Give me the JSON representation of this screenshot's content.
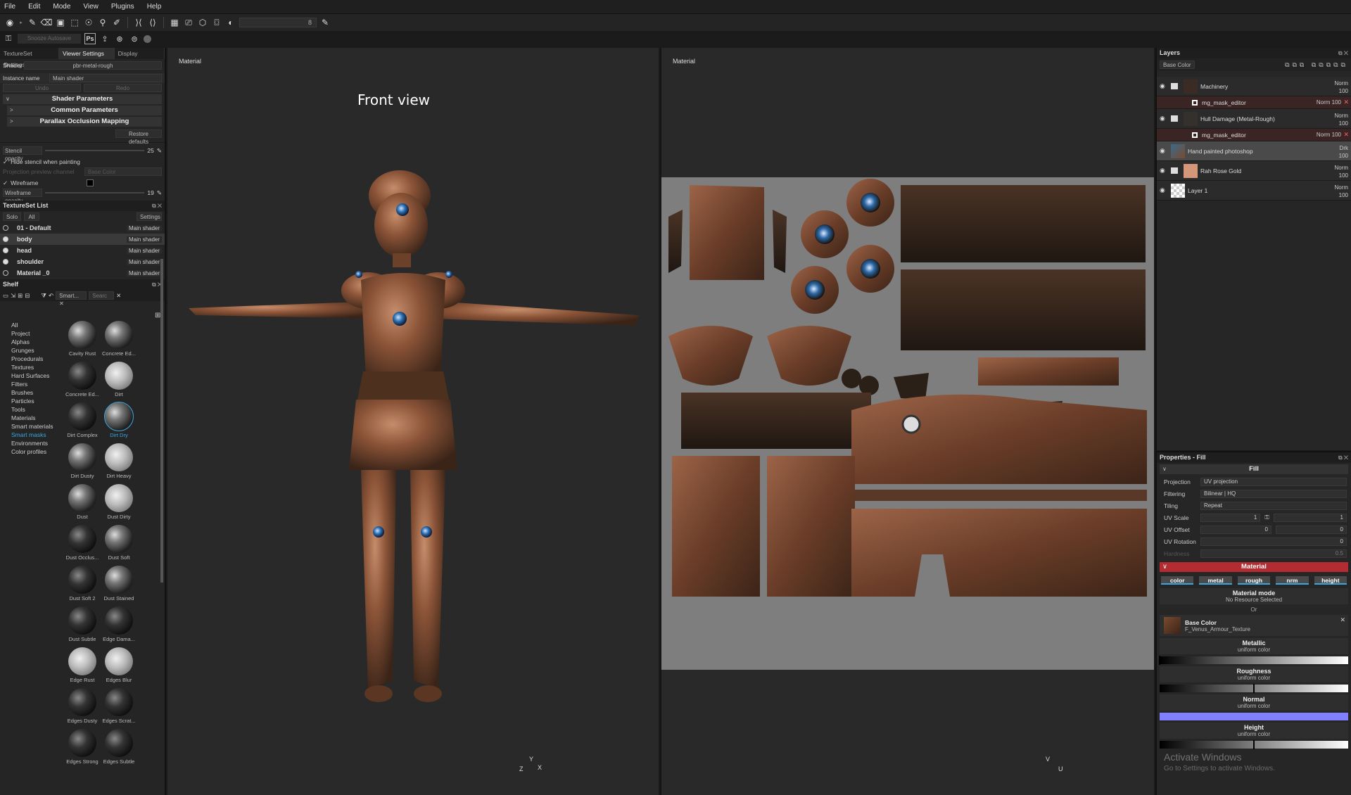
{
  "menubar": [
    "File",
    "Edit",
    "Mode",
    "View",
    "Plugins",
    "Help"
  ],
  "toolbar": {
    "value_field": "8"
  },
  "toolbar2": {
    "autosave_label": "Snooze Autosave",
    "ps_label": "Ps"
  },
  "left": {
    "tabs": [
      "TextureSet Settings",
      "Viewer Settings",
      "Display Settings"
    ],
    "shader_label": "Shader",
    "shader_value": "pbr-metal-rough",
    "instance_label": "Instance name",
    "instance_value": "Main shader",
    "undo": "Undo",
    "redo": "Redo",
    "sections": [
      "Shader Parameters",
      "Common Parameters",
      "Parallax Occlusion Mapping"
    ],
    "restore": "Restore defaults",
    "stencil_opacity_label": "Stencil opacity",
    "stencil_opacity_value": "25",
    "hide_stencil": "Hide stencil when painting",
    "projection_channel_label": "Projection preview channel",
    "projection_channel_value": "Base Color",
    "wireframe": "Wireframe",
    "wireframe_opacity_label": "Wireframe opacity",
    "wireframe_opacity_value": "19",
    "textureset_title": "TextureSet List",
    "solo": "Solo",
    "all": "All",
    "settings": "Settings",
    "texturesets": [
      {
        "name": "01 - Default",
        "shader": "Main shader"
      },
      {
        "name": "body",
        "shader": "Main shader"
      },
      {
        "name": "head",
        "shader": "Main shader"
      },
      {
        "name": "shoulder",
        "shader": "Main shader"
      },
      {
        "name": "Material _0",
        "shader": "Main shader"
      }
    ],
    "shelf_title": "Shelf",
    "shelf_tab": "Smart...",
    "shelf_search": "Searc",
    "categories": [
      "All",
      "Project",
      "Alphas",
      "Grunges",
      "Procedurals",
      "Textures",
      "Hard Surfaces",
      "Filters",
      "Brushes",
      "Particles",
      "Tools",
      "Materials",
      "Smart materials",
      "Smart masks",
      "Environments",
      "Color profiles"
    ],
    "shelf_items": [
      "Cavity Rust",
      "Concrete Ed...",
      "Concrete Ed...",
      "Dirt",
      "Dirt Complex",
      "Dirt Dry",
      "Dirt Dusty",
      "Dirt Heavy",
      "Dust",
      "Dust Dirty",
      "Dust Occlus...",
      "Dust Soft",
      "Dust Soft 2",
      "Dust Stained",
      "Dust Subtle",
      "Edge Dama...",
      "Edge Rust",
      "Edges Blur",
      "Edges Dusty",
      "Edges Scrat...",
      "Edges Strong",
      "Edges Subtle"
    ]
  },
  "viewport3d": {
    "label": "Material",
    "title": "Front view",
    "axes": [
      "Y",
      "Z",
      "X"
    ]
  },
  "viewport2d": {
    "label": "Material",
    "axes": [
      "V",
      "U"
    ]
  },
  "layers": {
    "title": "Layers",
    "channel": "Base Color",
    "items": [
      {
        "name": "Machinery",
        "mode": "Norm",
        "opacity": "100"
      },
      {
        "name": "mg_mask_editor",
        "mode": "Norm",
        "opacity": "100"
      },
      {
        "name": "Hull Damage (Metal-Rough)",
        "mode": "Norm",
        "opacity": "100"
      },
      {
        "name": "mg_mask_editor",
        "mode": "Norm",
        "opacity": "100"
      },
      {
        "name": "Hand painted photoshop",
        "mode": "Drk",
        "opacity": "100"
      },
      {
        "name": "Rah Rose Gold",
        "mode": "Norm",
        "opacity": "100"
      },
      {
        "name": "Layer 1",
        "mode": "Norm",
        "opacity": "100"
      }
    ]
  },
  "props": {
    "title": "Properties - Fill",
    "fill": "Fill",
    "projection_label": "Projection",
    "projection": "UV projection",
    "filtering_label": "Filtering",
    "filtering": "Bilinear | HQ",
    "tiling_label": "Tiling",
    "tiling": "Repeat",
    "uvscale_label": "UV Scale",
    "uvscale": "1",
    "uvscale2": "1",
    "uvoffset_label": "UV Offset",
    "uvoffset": "0",
    "uvoffset2": "0",
    "uvrot_label": "UV Rotation",
    "uvrot": "0",
    "hardness_label": "Hardness",
    "hardness": "0.5",
    "material_head": "Material",
    "channels": [
      "color",
      "metal",
      "rough",
      "nrm",
      "height"
    ],
    "material_mode": "Material mode",
    "no_resource": "No Resource Selected",
    "or": "Or",
    "base_color": "Base Color",
    "base_texture": "F_Venus_Armour_Texture",
    "metallic": "Metallic",
    "roughness": "Roughness",
    "normal": "Normal",
    "height": "Height",
    "uniform": "uniform color",
    "metallic_value": 0.0,
    "roughness_value": 0.5,
    "height_value": 0.5,
    "normal_color": "#7f7fff"
  },
  "watermark": {
    "line1": "Activate Windows",
    "line2": "Go to Settings to activate Windows."
  }
}
